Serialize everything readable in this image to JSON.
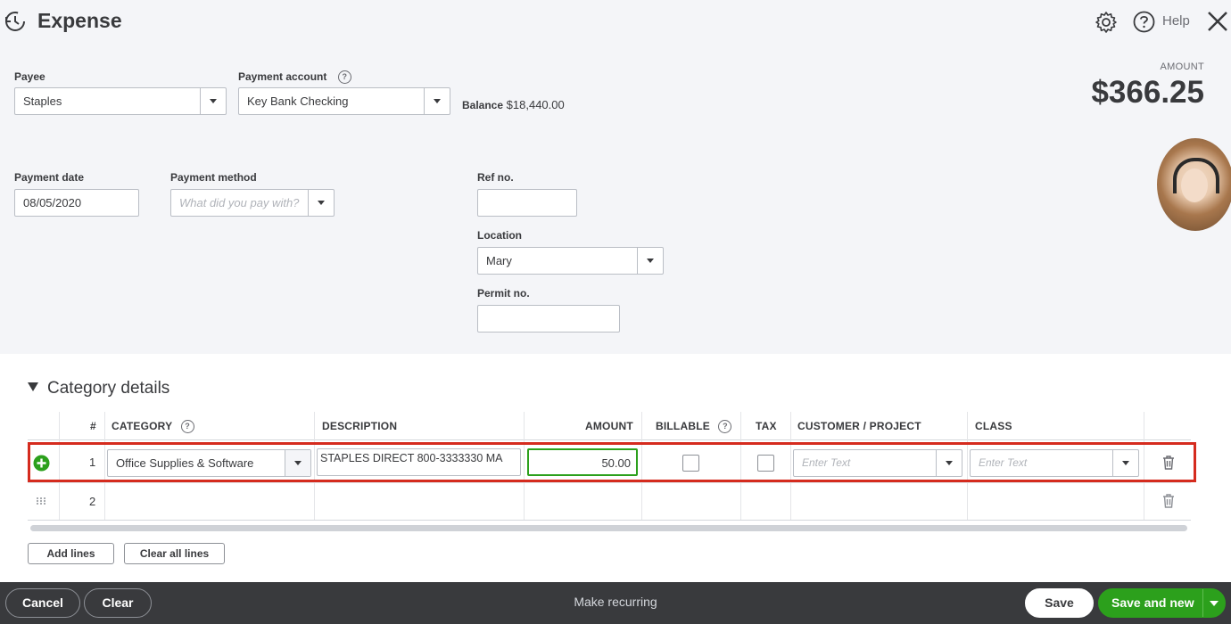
{
  "header": {
    "title": "Expense",
    "help_label": "Help"
  },
  "payee": {
    "label": "Payee",
    "value": "Staples"
  },
  "payment_account": {
    "label": "Payment account",
    "value": "Key Bank Checking"
  },
  "balance": {
    "label": "Balance",
    "value": "$18,440.00"
  },
  "amount": {
    "label": "AMOUNT",
    "value": "$366.25"
  },
  "payment_date": {
    "label": "Payment date",
    "value": "08/05/2020"
  },
  "payment_method": {
    "label": "Payment method",
    "placeholder": "What did you pay with?"
  },
  "ref_no": {
    "label": "Ref no.",
    "value": ""
  },
  "location": {
    "label": "Location",
    "value": "Mary"
  },
  "permit_no": {
    "label": "Permit no.",
    "value": ""
  },
  "category_details": {
    "title": "Category details",
    "columns": {
      "num": "#",
      "category": "CATEGORY",
      "description": "DESCRIPTION",
      "amount": "AMOUNT",
      "billable": "BILLABLE",
      "tax": "TAX",
      "customer_project": "CUSTOMER / PROJECT",
      "class": "CLASS"
    },
    "rows": [
      {
        "num": "1",
        "category": "Office Supplies & Software",
        "description": "STAPLES DIRECT 800-3333330 MA",
        "amount": "50.00",
        "customer_placeholder": "Enter Text",
        "class_placeholder": "Enter Text"
      },
      {
        "num": "2"
      }
    ],
    "add_lines_label": "Add lines",
    "clear_lines_label": "Clear all lines"
  },
  "footer": {
    "cancel_label": "Cancel",
    "clear_label": "Clear",
    "recurring_label": "Make recurring",
    "save_label": "Save",
    "save_new_label": "Save and new"
  },
  "colors": {
    "accent_green": "#2ca01c",
    "highlight_red": "#d52b1e",
    "footer_bg": "#393a3d"
  }
}
